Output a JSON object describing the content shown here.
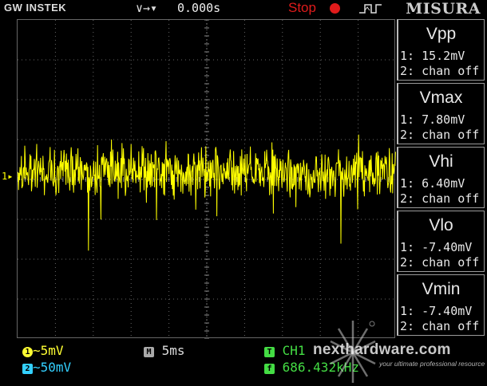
{
  "header": {
    "brand": "GW INSTEK",
    "trigger_mode_glyph": "∨→▾",
    "time_position": "0.000s",
    "run_state": "Stop",
    "menu_title": "MISURA"
  },
  "trace": {
    "channel_marker": "1▸",
    "color": "#ffff00"
  },
  "measurements": [
    {
      "name": "Vpp",
      "ch1": "1: 15.2mV",
      "ch2": "2: chan off"
    },
    {
      "name": "Vmax",
      "ch1": "1: 7.80mV",
      "ch2": "2: chan off"
    },
    {
      "name": "Vhi",
      "ch1": "1: 6.40mV",
      "ch2": "2: chan off"
    },
    {
      "name": "Vlo",
      "ch1": "1: -7.40mV",
      "ch2": "2: chan off"
    },
    {
      "name": "Vmin",
      "ch1": "1: -7.40mV",
      "ch2": "2: chan off"
    }
  ],
  "bottom": {
    "ch1_badge": "1",
    "ch1_scale": "∼5mV",
    "ch2_badge": "2",
    "ch2_scale": "∼50mV",
    "timebase_badge": "M",
    "timebase": "5ms",
    "trigger_badge": "T",
    "trigger_source": "CH1",
    "freq_badge": "f",
    "frequency": "686.432kHz"
  },
  "watermark": {
    "site": "nexthardware.com",
    "tagline": "your ultimate professional resource"
  },
  "colors": {
    "ch1": "#ffff33",
    "ch2": "#33d0ff",
    "trigger": "#44dd44",
    "stop": "#e01b1b"
  }
}
